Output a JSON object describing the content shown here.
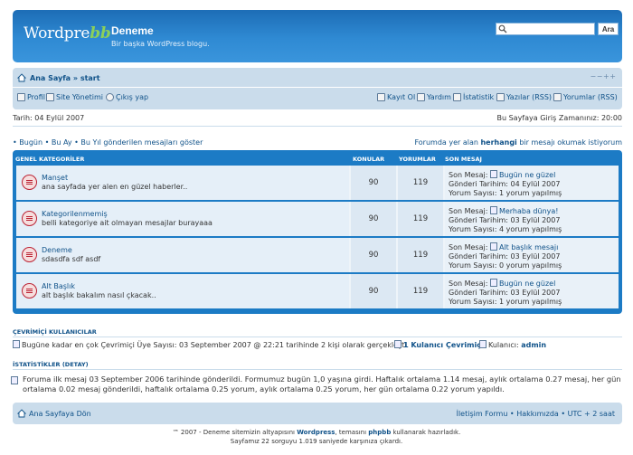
{
  "header": {
    "logo_prefix": "Wordpre",
    "logo_bb": "bb",
    "site_title": "Deneme",
    "site_description": "Bir başka WordPress blogu.",
    "search_placeholder": "",
    "search_button": "Ara"
  },
  "nav": {
    "breadcrumb": "Ana Sayfa » start",
    "font_size_icon": "− − + +",
    "left_links": [
      {
        "label": "Profil",
        "icon": "profile-icon"
      },
      {
        "label": "Site Yönetimi",
        "icon": "admin-icon"
      },
      {
        "label": "Çıkış yap",
        "icon": "logout-icon"
      }
    ],
    "right_links": [
      {
        "label": "Kayıt Ol",
        "icon": "register-icon"
      },
      {
        "label": "Yardım",
        "icon": "help-icon"
      },
      {
        "label": "İstatistik",
        "icon": "stats-icon"
      },
      {
        "label": "Yazılar (RSS)",
        "icon": "rss-icon"
      },
      {
        "label": "Yorumlar (RSS)",
        "icon": "rss-icon"
      }
    ]
  },
  "date_bar": {
    "date": "Tarih: 04 Eylül 2007",
    "last_visit": "Bu Sayfaya Giriş Zamanınız: 20:00"
  },
  "quick_links": "• Bugün • Bu Ay • Bu Yıl gönderilen mesajları göster",
  "unread_link_prefix": "Forumda yer alan ",
  "unread_link_bold": "herhangi",
  "unread_link_suffix": " bir mesajı okumak istiyorum",
  "forum": {
    "headers": {
      "category": "GENEL KATEGORİLER",
      "topics": "KONULAR",
      "posts": "YORUMLAR",
      "last": "SON MESAJ"
    },
    "rows": [
      {
        "name": "Manşet",
        "desc": "ana sayfada yer alen en güzel haberler..",
        "topics": "90",
        "posts": "119",
        "last_label": "Son Mesaj: ",
        "last_title": "Bugün ne güzel",
        "last_date": "Gönderi Tarihim: 04 Eylül 2007",
        "last_comments": "Yorum Sayısı: 1 yorum yapılmış"
      },
      {
        "name": "Kategorilenmemiş",
        "desc": "belli kategoriye ait olmayan mesajlar burayaaa",
        "topics": "90",
        "posts": "119",
        "last_label": "Son Mesaj: ",
        "last_title": "Merhaba dünya!",
        "last_date": "Gönderi Tarihim: 03 Eylül 2007",
        "last_comments": "Yorum Sayısı: 4 yorum yapılmış"
      },
      {
        "name": "Deneme",
        "desc": "sdasdfa sdf asdf",
        "topics": "90",
        "posts": "119",
        "last_label": "Son Mesaj: ",
        "last_title": "Alt başlık mesajı",
        "last_date": "Gönderi Tarihim: 03 Eylül 2007",
        "last_comments": "Yorum Sayısı: 0 yorum yapılmış"
      },
      {
        "name": "Alt Başlık",
        "desc": "alt başlık bakalım nasıl çkacak..",
        "topics": "90",
        "posts": "119",
        "last_label": "Son Mesaj: ",
        "last_title": "Bugün ne güzel",
        "last_date": "Gönderi Tarihim: 03 Eylül 2007",
        "last_comments": "Yorum Sayısı: 1 yorum yapılmış"
      }
    ]
  },
  "online": {
    "title": "ÇEVRİMİÇİ KULLANICILAR",
    "record": "Bugüne kadar en çok Çevrimiçi Üye Sayısı: 03 September 2007 @ 22:21 tarihinde 2 kişi olarak gerçekleşti.",
    "online_count": "1 Kulanıcı Çevrimiçi",
    "users_label": "Kulanıcı: ",
    "users": "admin"
  },
  "stats": {
    "title": "İSTATİSTİKLER (DETAY)",
    "line1": "Foruma ilk mesaj 03 September 2006 tarihinde gönderildi. Formumuz bugün 1,0 yaşına girdi. Haftalık ortalama 1.14 mesaj, aylık ortalama 0.27 mesaj, her gün",
    "line2": "ortalama 0.02 mesaj gönderildi, haftalık ortalama 0.25 yorum, aylık ortalama 0.25 yorum, her gün ortalama 0.22 yorum yapıldı."
  },
  "footer": {
    "home": "Ana Sayfaya Dön",
    "right": "İletişim Formu • Hakkımızda • UTC + 2 saat",
    "copy_pre": "™ 2007 - Deneme sitemizin altyapısını ",
    "copy_wp": "Wordpress",
    "copy_mid": ", temasını ",
    "copy_bb": "phpbb",
    "copy_post": " kullanarak hazırladık.",
    "copy_line2": "Sayfamız 22 sorguyu 1.019 saniyede karşınıza çıkardı."
  }
}
